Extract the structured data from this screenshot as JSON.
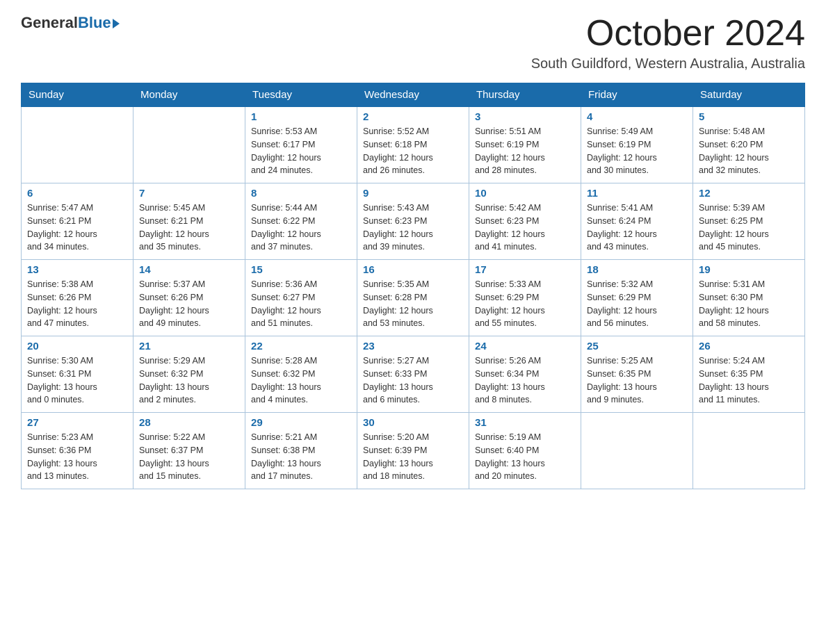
{
  "header": {
    "logo_general": "General",
    "logo_blue": "Blue",
    "main_title": "October 2024",
    "subtitle": "South Guildford, Western Australia, Australia"
  },
  "days_of_week": [
    "Sunday",
    "Monday",
    "Tuesday",
    "Wednesday",
    "Thursday",
    "Friday",
    "Saturday"
  ],
  "weeks": [
    [
      {
        "day": "",
        "info": ""
      },
      {
        "day": "",
        "info": ""
      },
      {
        "day": "1",
        "info": "Sunrise: 5:53 AM\nSunset: 6:17 PM\nDaylight: 12 hours\nand 24 minutes."
      },
      {
        "day": "2",
        "info": "Sunrise: 5:52 AM\nSunset: 6:18 PM\nDaylight: 12 hours\nand 26 minutes."
      },
      {
        "day": "3",
        "info": "Sunrise: 5:51 AM\nSunset: 6:19 PM\nDaylight: 12 hours\nand 28 minutes."
      },
      {
        "day": "4",
        "info": "Sunrise: 5:49 AM\nSunset: 6:19 PM\nDaylight: 12 hours\nand 30 minutes."
      },
      {
        "day": "5",
        "info": "Sunrise: 5:48 AM\nSunset: 6:20 PM\nDaylight: 12 hours\nand 32 minutes."
      }
    ],
    [
      {
        "day": "6",
        "info": "Sunrise: 5:47 AM\nSunset: 6:21 PM\nDaylight: 12 hours\nand 34 minutes."
      },
      {
        "day": "7",
        "info": "Sunrise: 5:45 AM\nSunset: 6:21 PM\nDaylight: 12 hours\nand 35 minutes."
      },
      {
        "day": "8",
        "info": "Sunrise: 5:44 AM\nSunset: 6:22 PM\nDaylight: 12 hours\nand 37 minutes."
      },
      {
        "day": "9",
        "info": "Sunrise: 5:43 AM\nSunset: 6:23 PM\nDaylight: 12 hours\nand 39 minutes."
      },
      {
        "day": "10",
        "info": "Sunrise: 5:42 AM\nSunset: 6:23 PM\nDaylight: 12 hours\nand 41 minutes."
      },
      {
        "day": "11",
        "info": "Sunrise: 5:41 AM\nSunset: 6:24 PM\nDaylight: 12 hours\nand 43 minutes."
      },
      {
        "day": "12",
        "info": "Sunrise: 5:39 AM\nSunset: 6:25 PM\nDaylight: 12 hours\nand 45 minutes."
      }
    ],
    [
      {
        "day": "13",
        "info": "Sunrise: 5:38 AM\nSunset: 6:26 PM\nDaylight: 12 hours\nand 47 minutes."
      },
      {
        "day": "14",
        "info": "Sunrise: 5:37 AM\nSunset: 6:26 PM\nDaylight: 12 hours\nand 49 minutes."
      },
      {
        "day": "15",
        "info": "Sunrise: 5:36 AM\nSunset: 6:27 PM\nDaylight: 12 hours\nand 51 minutes."
      },
      {
        "day": "16",
        "info": "Sunrise: 5:35 AM\nSunset: 6:28 PM\nDaylight: 12 hours\nand 53 minutes."
      },
      {
        "day": "17",
        "info": "Sunrise: 5:33 AM\nSunset: 6:29 PM\nDaylight: 12 hours\nand 55 minutes."
      },
      {
        "day": "18",
        "info": "Sunrise: 5:32 AM\nSunset: 6:29 PM\nDaylight: 12 hours\nand 56 minutes."
      },
      {
        "day": "19",
        "info": "Sunrise: 5:31 AM\nSunset: 6:30 PM\nDaylight: 12 hours\nand 58 minutes."
      }
    ],
    [
      {
        "day": "20",
        "info": "Sunrise: 5:30 AM\nSunset: 6:31 PM\nDaylight: 13 hours\nand 0 minutes."
      },
      {
        "day": "21",
        "info": "Sunrise: 5:29 AM\nSunset: 6:32 PM\nDaylight: 13 hours\nand 2 minutes."
      },
      {
        "day": "22",
        "info": "Sunrise: 5:28 AM\nSunset: 6:32 PM\nDaylight: 13 hours\nand 4 minutes."
      },
      {
        "day": "23",
        "info": "Sunrise: 5:27 AM\nSunset: 6:33 PM\nDaylight: 13 hours\nand 6 minutes."
      },
      {
        "day": "24",
        "info": "Sunrise: 5:26 AM\nSunset: 6:34 PM\nDaylight: 13 hours\nand 8 minutes."
      },
      {
        "day": "25",
        "info": "Sunrise: 5:25 AM\nSunset: 6:35 PM\nDaylight: 13 hours\nand 9 minutes."
      },
      {
        "day": "26",
        "info": "Sunrise: 5:24 AM\nSunset: 6:35 PM\nDaylight: 13 hours\nand 11 minutes."
      }
    ],
    [
      {
        "day": "27",
        "info": "Sunrise: 5:23 AM\nSunset: 6:36 PM\nDaylight: 13 hours\nand 13 minutes."
      },
      {
        "day": "28",
        "info": "Sunrise: 5:22 AM\nSunset: 6:37 PM\nDaylight: 13 hours\nand 15 minutes."
      },
      {
        "day": "29",
        "info": "Sunrise: 5:21 AM\nSunset: 6:38 PM\nDaylight: 13 hours\nand 17 minutes."
      },
      {
        "day": "30",
        "info": "Sunrise: 5:20 AM\nSunset: 6:39 PM\nDaylight: 13 hours\nand 18 minutes."
      },
      {
        "day": "31",
        "info": "Sunrise: 5:19 AM\nSunset: 6:40 PM\nDaylight: 13 hours\nand 20 minutes."
      },
      {
        "day": "",
        "info": ""
      },
      {
        "day": "",
        "info": ""
      }
    ]
  ]
}
